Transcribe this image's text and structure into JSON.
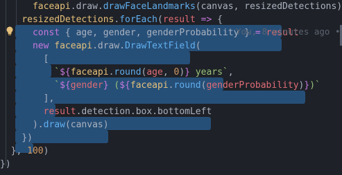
{
  "editor": {
    "blame_annotation": "You, 8 minutes ago •",
    "lines": [
      [
        {
          "t": "      ",
          "c": "plain"
        },
        {
          "t": "faceapi",
          "c": "var"
        },
        {
          "t": ".",
          "c": "punc"
        },
        {
          "t": "draw",
          "c": "prop"
        },
        {
          "t": ".",
          "c": "punc"
        },
        {
          "t": "drawFaceLandmarks",
          "c": "fn"
        },
        {
          "t": "(",
          "c": "punc"
        },
        {
          "t": "canvas",
          "c": "plain"
        },
        {
          "t": ", ",
          "c": "punc"
        },
        {
          "t": "resizedDetections",
          "c": "plain"
        },
        {
          "t": ")",
          "c": "punc"
        }
      ],
      [
        {
          "t": "    ",
          "c": "plain"
        },
        {
          "t": "resizedDetections",
          "c": "var"
        },
        {
          "t": ".",
          "c": "punc"
        },
        {
          "t": "forEach",
          "c": "fn"
        },
        {
          "t": "(",
          "c": "punc"
        },
        {
          "t": "result",
          "c": "param"
        },
        {
          "t": " ",
          "c": "plain"
        },
        {
          "t": "=>",
          "c": "kw"
        },
        {
          "t": " {",
          "c": "punc"
        }
      ],
      [
        {
          "t": "      ",
          "c": "plain"
        },
        {
          "t": "const",
          "c": "kw"
        },
        {
          "t": " { ",
          "c": "punc"
        },
        {
          "t": "age",
          "c": "plain"
        },
        {
          "t": ", ",
          "c": "punc"
        },
        {
          "t": "gender",
          "c": "plain"
        },
        {
          "t": ", ",
          "c": "punc"
        },
        {
          "t": "genderProbability",
          "c": "plain"
        },
        {
          "t": " } ",
          "c": "punc"
        },
        {
          "t": "=",
          "c": "kw"
        },
        {
          "t": " ",
          "c": "plain"
        },
        {
          "t": "result",
          "c": "param"
        }
      ],
      [
        {
          "t": "      ",
          "c": "plain"
        },
        {
          "t": "new",
          "c": "kw"
        },
        {
          "t": " ",
          "c": "plain"
        },
        {
          "t": "faceapi",
          "c": "var"
        },
        {
          "t": ".",
          "c": "punc"
        },
        {
          "t": "draw",
          "c": "prop"
        },
        {
          "t": ".",
          "c": "punc"
        },
        {
          "t": "DrawTextField",
          "c": "fn"
        },
        {
          "t": "(",
          "c": "punc"
        }
      ],
      [
        {
          "t": "        ",
          "c": "plain"
        },
        {
          "t": "[",
          "c": "punc"
        }
      ],
      [
        {
          "t": "          ",
          "c": "plain"
        },
        {
          "t": "`",
          "c": "str"
        },
        {
          "t": "${",
          "c": "interp"
        },
        {
          "t": "faceapi",
          "c": "var"
        },
        {
          "t": ".",
          "c": "punc"
        },
        {
          "t": "round",
          "c": "fn"
        },
        {
          "t": "(",
          "c": "punc"
        },
        {
          "t": "age",
          "c": "ivar"
        },
        {
          "t": ", ",
          "c": "punc"
        },
        {
          "t": "0",
          "c": "num"
        },
        {
          "t": ")",
          "c": "punc"
        },
        {
          "t": "}",
          "c": "interp"
        },
        {
          "t": " years",
          "c": "str"
        },
        {
          "t": "`",
          "c": "str"
        },
        {
          "t": ",",
          "c": "punc"
        }
      ],
      [
        {
          "t": "          ",
          "c": "plain"
        },
        {
          "t": "`",
          "c": "str"
        },
        {
          "t": "${",
          "c": "interp"
        },
        {
          "t": "gender",
          "c": "ivar"
        },
        {
          "t": "}",
          "c": "interp"
        },
        {
          "t": " (",
          "c": "str"
        },
        {
          "t": "${",
          "c": "interp"
        },
        {
          "t": "faceapi",
          "c": "var"
        },
        {
          "t": ".",
          "c": "punc"
        },
        {
          "t": "round",
          "c": "fn"
        },
        {
          "t": "(",
          "c": "punc"
        },
        {
          "t": "genderProbability",
          "c": "ivar"
        },
        {
          "t": ")",
          "c": "punc"
        },
        {
          "t": "}",
          "c": "interp"
        },
        {
          "t": ")",
          "c": "str"
        },
        {
          "t": "`",
          "c": "str"
        }
      ],
      [
        {
          "t": "        ",
          "c": "plain"
        },
        {
          "t": "],",
          "c": "punc"
        }
      ],
      [
        {
          "t": "        ",
          "c": "plain"
        },
        {
          "t": "result",
          "c": "param"
        },
        {
          "t": ".",
          "c": "punc"
        },
        {
          "t": "detection",
          "c": "prop"
        },
        {
          "t": ".",
          "c": "punc"
        },
        {
          "t": "box",
          "c": "prop"
        },
        {
          "t": ".",
          "c": "punc"
        },
        {
          "t": "bottomLeft",
          "c": "prop"
        }
      ],
      [
        {
          "t": "      ",
          "c": "plain"
        },
        {
          "t": ").",
          "c": "punc"
        },
        {
          "t": "draw",
          "c": "fn"
        },
        {
          "t": "(",
          "c": "punc"
        },
        {
          "t": "canvas",
          "c": "plain"
        },
        {
          "t": ")",
          "c": "punc"
        }
      ],
      [
        {
          "t": "    ",
          "c": "plain"
        },
        {
          "t": "})",
          "c": "punc"
        }
      ],
      [
        {
          "t": "  ",
          "c": "plain"
        },
        {
          "t": "}, ",
          "c": "punc"
        },
        {
          "t": "100",
          "c": "num"
        },
        {
          "t": ")",
          "c": "punc"
        }
      ],
      [
        {
          "t": "})",
          "c": "punc"
        }
      ]
    ]
  }
}
